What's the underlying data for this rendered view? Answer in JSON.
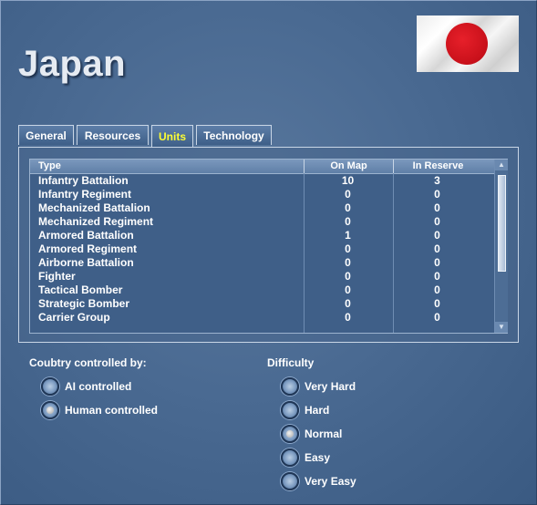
{
  "country": {
    "name": "Japan"
  },
  "tabs": [
    {
      "label": "General",
      "active": false
    },
    {
      "label": "Resources",
      "active": false
    },
    {
      "label": "Units",
      "active": true
    },
    {
      "label": "Technology",
      "active": false
    }
  ],
  "units_table": {
    "headers": {
      "type": "Type",
      "on_map": "On Map",
      "in_reserve": "In Reserve"
    },
    "rows": [
      {
        "type": "Infantry Battalion",
        "on_map": "10",
        "in_reserve": "3"
      },
      {
        "type": "Infantry Regiment",
        "on_map": "0",
        "in_reserve": "0"
      },
      {
        "type": "Mechanized Battalion",
        "on_map": "0",
        "in_reserve": "0"
      },
      {
        "type": "Mechanized Regiment",
        "on_map": "0",
        "in_reserve": "0"
      },
      {
        "type": "Armored Battalion",
        "on_map": "1",
        "in_reserve": "0"
      },
      {
        "type": "Armored Regiment",
        "on_map": "0",
        "in_reserve": "0"
      },
      {
        "type": "Airborne Battalion",
        "on_map": "0",
        "in_reserve": "0"
      },
      {
        "type": "Fighter",
        "on_map": "0",
        "in_reserve": "0"
      },
      {
        "type": "Tactical Bomber",
        "on_map": "0",
        "in_reserve": "0"
      },
      {
        "type": "Strategic Bomber",
        "on_map": "0",
        "in_reserve": "0"
      },
      {
        "type": "Carrier Group",
        "on_map": "0",
        "in_reserve": "0"
      }
    ]
  },
  "control": {
    "label": "Coubtry controlled by:",
    "options": [
      {
        "label": "AI controlled",
        "selected": false
      },
      {
        "label": "Human controlled",
        "selected": true
      }
    ]
  },
  "difficulty": {
    "label": "Difficulty",
    "options": [
      {
        "label": "Very Hard",
        "selected": false
      },
      {
        "label": "Hard",
        "selected": false
      },
      {
        "label": "Normal",
        "selected": true
      },
      {
        "label": "Easy",
        "selected": false
      },
      {
        "label": "Very Easy",
        "selected": false
      }
    ]
  },
  "colors": {
    "background": "#4a6a92",
    "active_tab_text": "#ffff33",
    "flag_red": "#c8101a"
  },
  "icons": {
    "flag": "japan-flag-icon",
    "scroll_up": "scroll-up-arrow-icon",
    "scroll_down": "scroll-down-arrow-icon"
  }
}
